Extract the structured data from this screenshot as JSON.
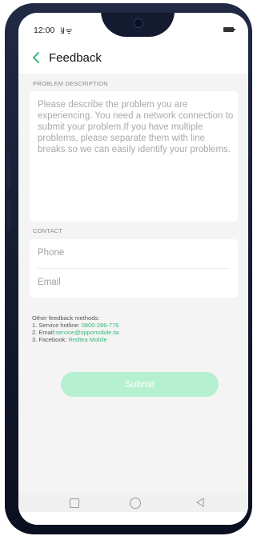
{
  "status_bar": {
    "time": "12:00",
    "signal": "⁞ıl ᯤ"
  },
  "header": {
    "title": "Feedback"
  },
  "problem": {
    "section_label": "PROBLEM DESCRIPTION",
    "placeholder": "Please describe the problem you are experiencing. You need a network connection to submit your problem.If you have multiple problems, please separate them with line breaks so we can easily identify your problems."
  },
  "contact": {
    "section_label": "CONTACT",
    "phone_placeholder": "Phone",
    "email_placeholder": "Email"
  },
  "other_methods": {
    "heading": "Other feedback methods:",
    "hotline_label": "1. Service hotline: ",
    "hotline_value": "0800-286-776",
    "email_label": "2. Email:",
    "email_value": "service@oppomobile.tw",
    "facebook_label": "3. Facebook: ",
    "facebook_value": "Redtea Mobile"
  },
  "submit": {
    "label": "Submit"
  },
  "colors": {
    "accent": "#38b87c",
    "submit_bg": "#b5f0d1",
    "frame": "#141b30",
    "screen_bg": "#f4f4f4"
  },
  "icons": [
    "back-chevron-icon",
    "battery-icon",
    "front-camera-icon",
    "nav-recents-icon",
    "nav-home-icon",
    "nav-back-icon"
  ]
}
